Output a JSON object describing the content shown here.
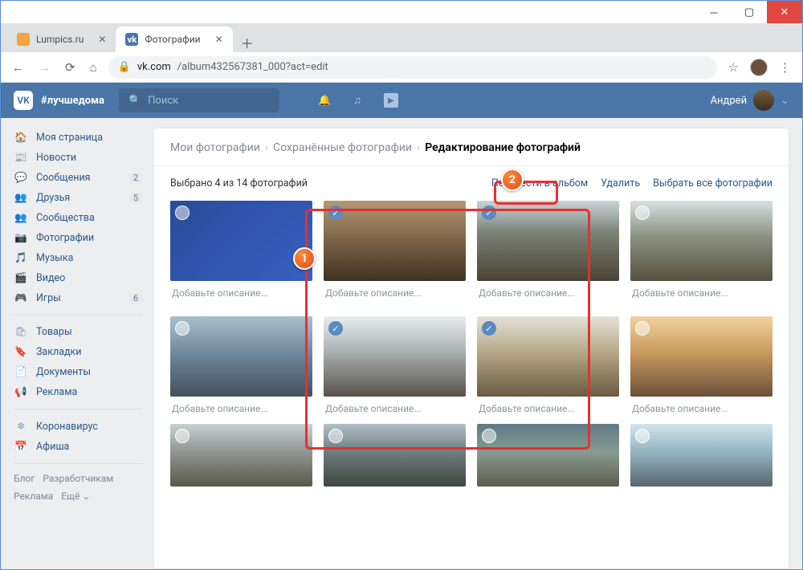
{
  "browser": {
    "tabs": [
      {
        "title": "Lumpics.ru",
        "favicon": "lumpics",
        "active": false
      },
      {
        "title": "Фотографии",
        "favicon": "vk",
        "active": true
      }
    ],
    "url_host": "vk.com",
    "url_path": "/album432567381_000?act=edit"
  },
  "vk": {
    "hashtag": "#лучшедома",
    "search_placeholder": "Поиск",
    "user_name": "Андрей"
  },
  "sidebar": {
    "items": [
      {
        "icon": "🏠",
        "label": "Моя страница"
      },
      {
        "icon": "📰",
        "label": "Новости"
      },
      {
        "icon": "💬",
        "label": "Сообщения",
        "badge": "2"
      },
      {
        "icon": "👥",
        "label": "Друзья",
        "badge": "5"
      },
      {
        "icon": "👥",
        "label": "Сообщества"
      },
      {
        "icon": "📷",
        "label": "Фотографии"
      },
      {
        "icon": "🎵",
        "label": "Музыка"
      },
      {
        "icon": "🎬",
        "label": "Видео"
      },
      {
        "icon": "🎮",
        "label": "Игры",
        "badge": "6"
      }
    ],
    "items2": [
      {
        "icon": "🛍",
        "label": "Товары"
      },
      {
        "icon": "🔖",
        "label": "Закладки"
      },
      {
        "icon": "📄",
        "label": "Документы"
      },
      {
        "icon": "📢",
        "label": "Реклама"
      }
    ],
    "items3": [
      {
        "icon": "❄",
        "label": "Коронавирус"
      },
      {
        "icon": "📅",
        "label": "Афиша"
      }
    ],
    "footer": [
      "Блог",
      "Разработчикам",
      "Реклама",
      "Ещё ⌄"
    ]
  },
  "breadcrumbs": {
    "a": "Мои фотографии",
    "b": "Сохранённые фотографии",
    "c": "Редактирование фотографий"
  },
  "toolbar": {
    "selected_label": "Выбрано 4 из 14 фотографий",
    "move_label": "Перенести в альбом",
    "delete_label": "Удалить",
    "select_all_label": "Выбрать все фотографии"
  },
  "photos": {
    "grid1": [
      {
        "t": "t0",
        "sel": false
      },
      {
        "t": "t1",
        "sel": true
      },
      {
        "t": "t2",
        "sel": true
      },
      {
        "t": "t3",
        "sel": false
      },
      {
        "t": "t4",
        "sel": false
      },
      {
        "t": "t5",
        "sel": true
      },
      {
        "t": "t6",
        "sel": true
      },
      {
        "t": "t7",
        "sel": false
      }
    ],
    "grid2": [
      {
        "t": "t8"
      },
      {
        "t": "t9"
      },
      {
        "t": "t10"
      },
      {
        "t": "t11"
      }
    ],
    "desc_placeholder": "Добавьте описание..."
  },
  "annotations": {
    "step1": "1",
    "step2": "2"
  }
}
